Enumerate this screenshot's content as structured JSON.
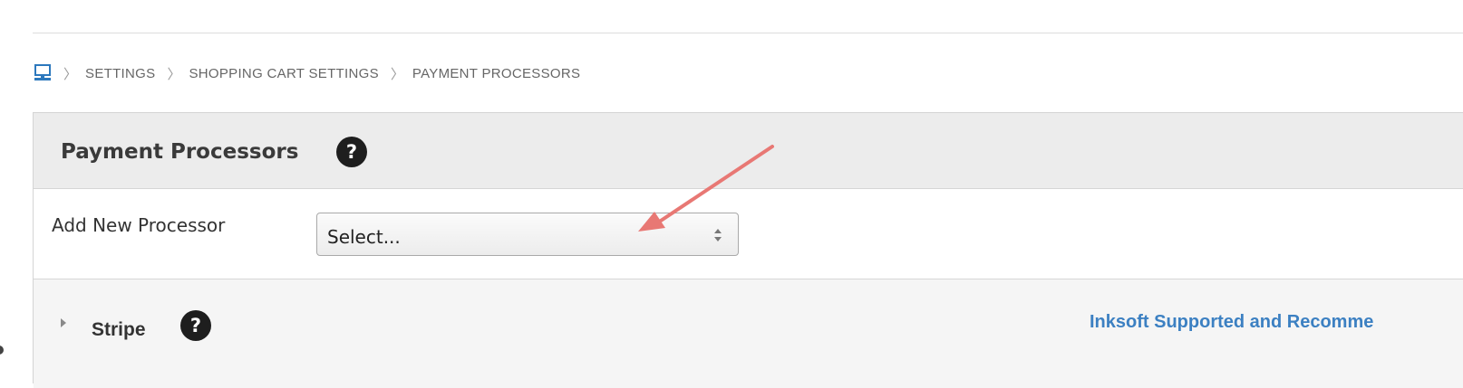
{
  "breadcrumb": {
    "home_icon": "computer-monitor-icon",
    "separator": "〉",
    "items": [
      "SETTINGS",
      "SHOPPING CART SETTINGS",
      "PAYMENT PROCESSORS"
    ]
  },
  "panel": {
    "title": "Payment Processors",
    "help_glyph": "?"
  },
  "form": {
    "add_label": "Add New Processor",
    "select_value": "Select..."
  },
  "processors": [
    {
      "name": "Stripe",
      "help_glyph": "?",
      "link_text": "Inksoft Supported and Recomme"
    }
  ],
  "colors": {
    "link": "#3c80c2",
    "annotation_arrow": "#e87874",
    "home_icon": "#2c78bd",
    "header_bg": "#ececec"
  }
}
